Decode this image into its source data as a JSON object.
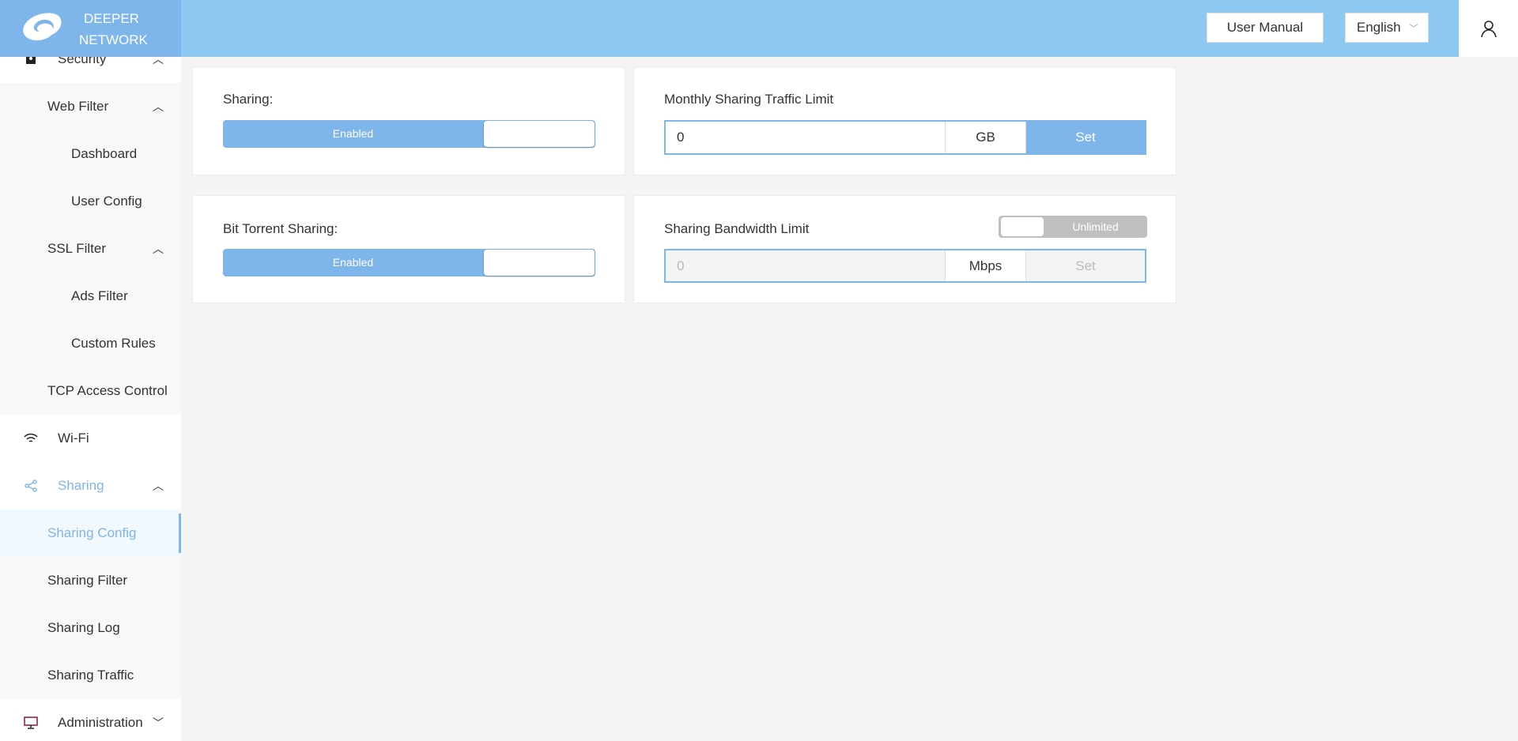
{
  "brand": {
    "line1": "DEEPER",
    "line2": "NETWORK"
  },
  "header": {
    "user_manual": "User Manual",
    "language": "English"
  },
  "sidebar": {
    "items": [
      {
        "label": "Security"
      },
      {
        "label": "Web Filter"
      },
      {
        "label": "Dashboard"
      },
      {
        "label": "User Config"
      },
      {
        "label": "SSL Filter"
      },
      {
        "label": "Ads Filter"
      },
      {
        "label": "Custom Rules"
      },
      {
        "label": "TCP Access Control"
      },
      {
        "label": "Wi-Fi"
      },
      {
        "label": "Sharing"
      },
      {
        "label": "Sharing Config"
      },
      {
        "label": "Sharing Filter"
      },
      {
        "label": "Sharing Log"
      },
      {
        "label": "Sharing Traffic"
      },
      {
        "label": "Administration"
      }
    ]
  },
  "sharing": {
    "label": "Sharing:",
    "state": "Enabled"
  },
  "bittorrent": {
    "label": "Bit Torrent Sharing:",
    "state": "Enabled"
  },
  "traffic_limit": {
    "title": "Monthly Sharing Traffic Limit",
    "value": "0",
    "unit": "GB",
    "set": "Set"
  },
  "bandwidth_limit": {
    "title": "Sharing Bandwidth Limit",
    "toggle": "Unlimited",
    "placeholder": "0",
    "unit": "Mbps",
    "set": "Set"
  },
  "colors": {
    "accent": "#7eb5ea",
    "header": "#8dc8f3"
  }
}
